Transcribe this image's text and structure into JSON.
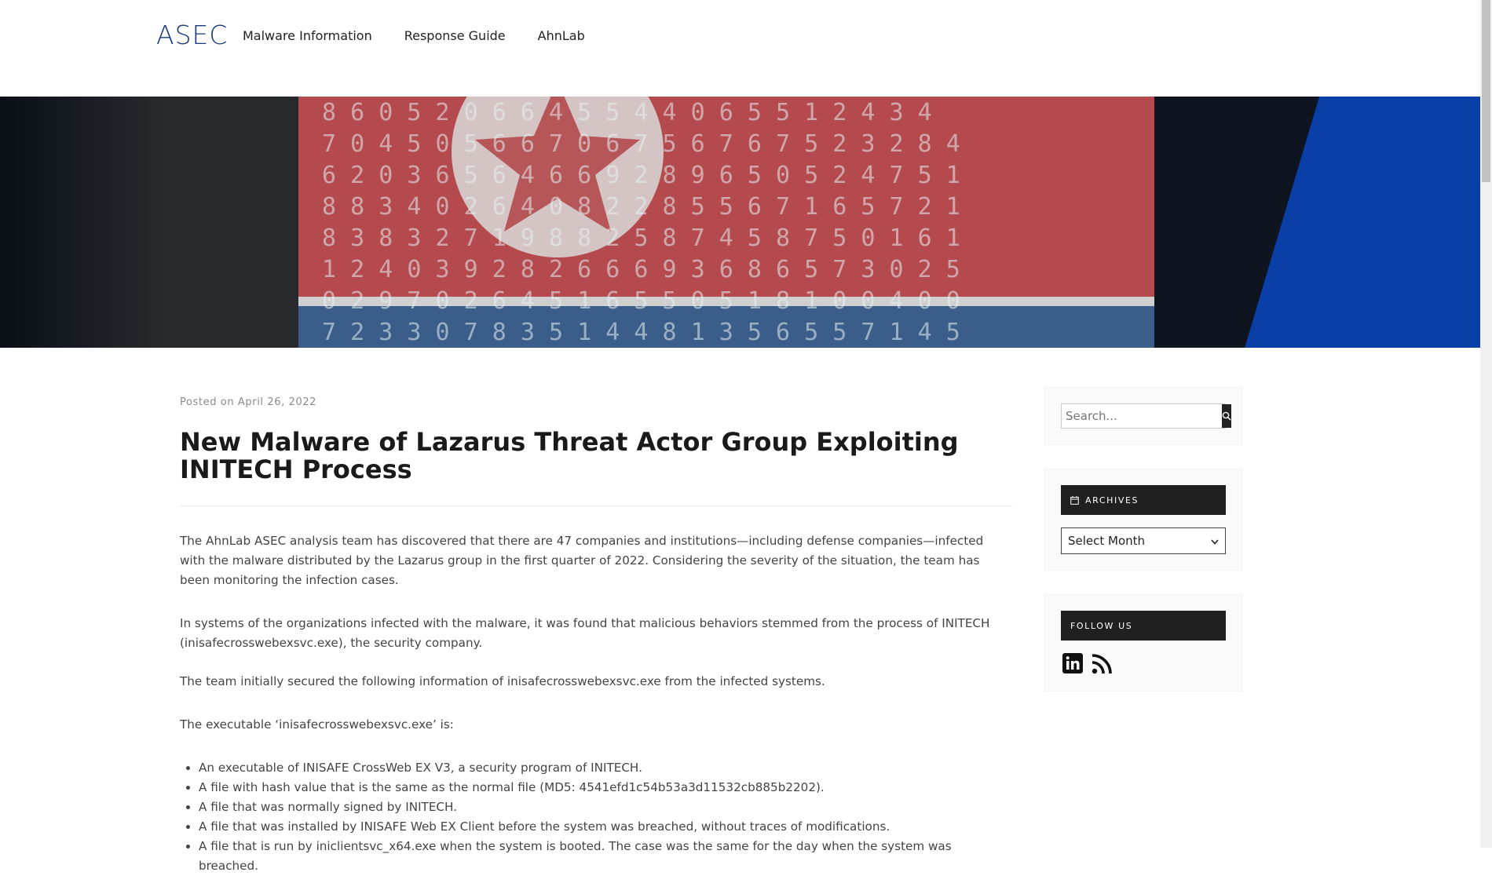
{
  "header": {
    "logo_text": "ASEC",
    "nav": [
      {
        "label": "Malware Information"
      },
      {
        "label": "Response Guide"
      },
      {
        "label": "AhnLab"
      }
    ]
  },
  "post": {
    "posted_prefix": "Posted on",
    "date": "April 26, 2022",
    "title": "New Malware of Lazarus Threat Actor Group Exploiting INITECH Process",
    "paragraphs": [
      "The AhnLab ASEC analysis team has discovered that there are 47 companies and institutions—including defense companies—infected with the malware distributed by the Lazarus group in the first quarter of 2022. Considering the severity of the situation, the team has been monitoring the infection cases.",
      "In systems of the organizations infected with the malware, it was found that malicious behaviors stemmed from the process of INITECH (inisafecrosswebexsvc.exe), the security company.",
      "The team initially secured the following information of inisafecrosswebexsvc.exe from the infected systems.",
      "The executable ‘inisafecrosswebexsvc.exe’ is:"
    ],
    "list": [
      "An executable of INISAFE CrossWeb EX V3, a security program of INITECH.",
      "A file with hash value that is the same as the normal file (MD5: 4541efd1c54b53a3d11532cb885b2202).",
      "A file that was normally signed by INITECH.",
      "A file that was installed by INISAFE Web EX Client before the system was breached, without traces of modifications.",
      "A file that is run by iniclientsvc_x64.exe when the system is booted. The case was the same for the day when the system was breached."
    ]
  },
  "sidebar": {
    "search": {
      "placeholder": "Search..."
    },
    "archives": {
      "title": "Archives",
      "select_value": "Select Month"
    },
    "follow": {
      "title": "Follow Us",
      "icons": [
        "linkedin-icon",
        "rss-icon"
      ]
    }
  },
  "colors": {
    "logo": "#1a3a7a",
    "widget_title_bg": "#202020",
    "title_text": "#1a1a1a",
    "body_text": "#444444"
  }
}
